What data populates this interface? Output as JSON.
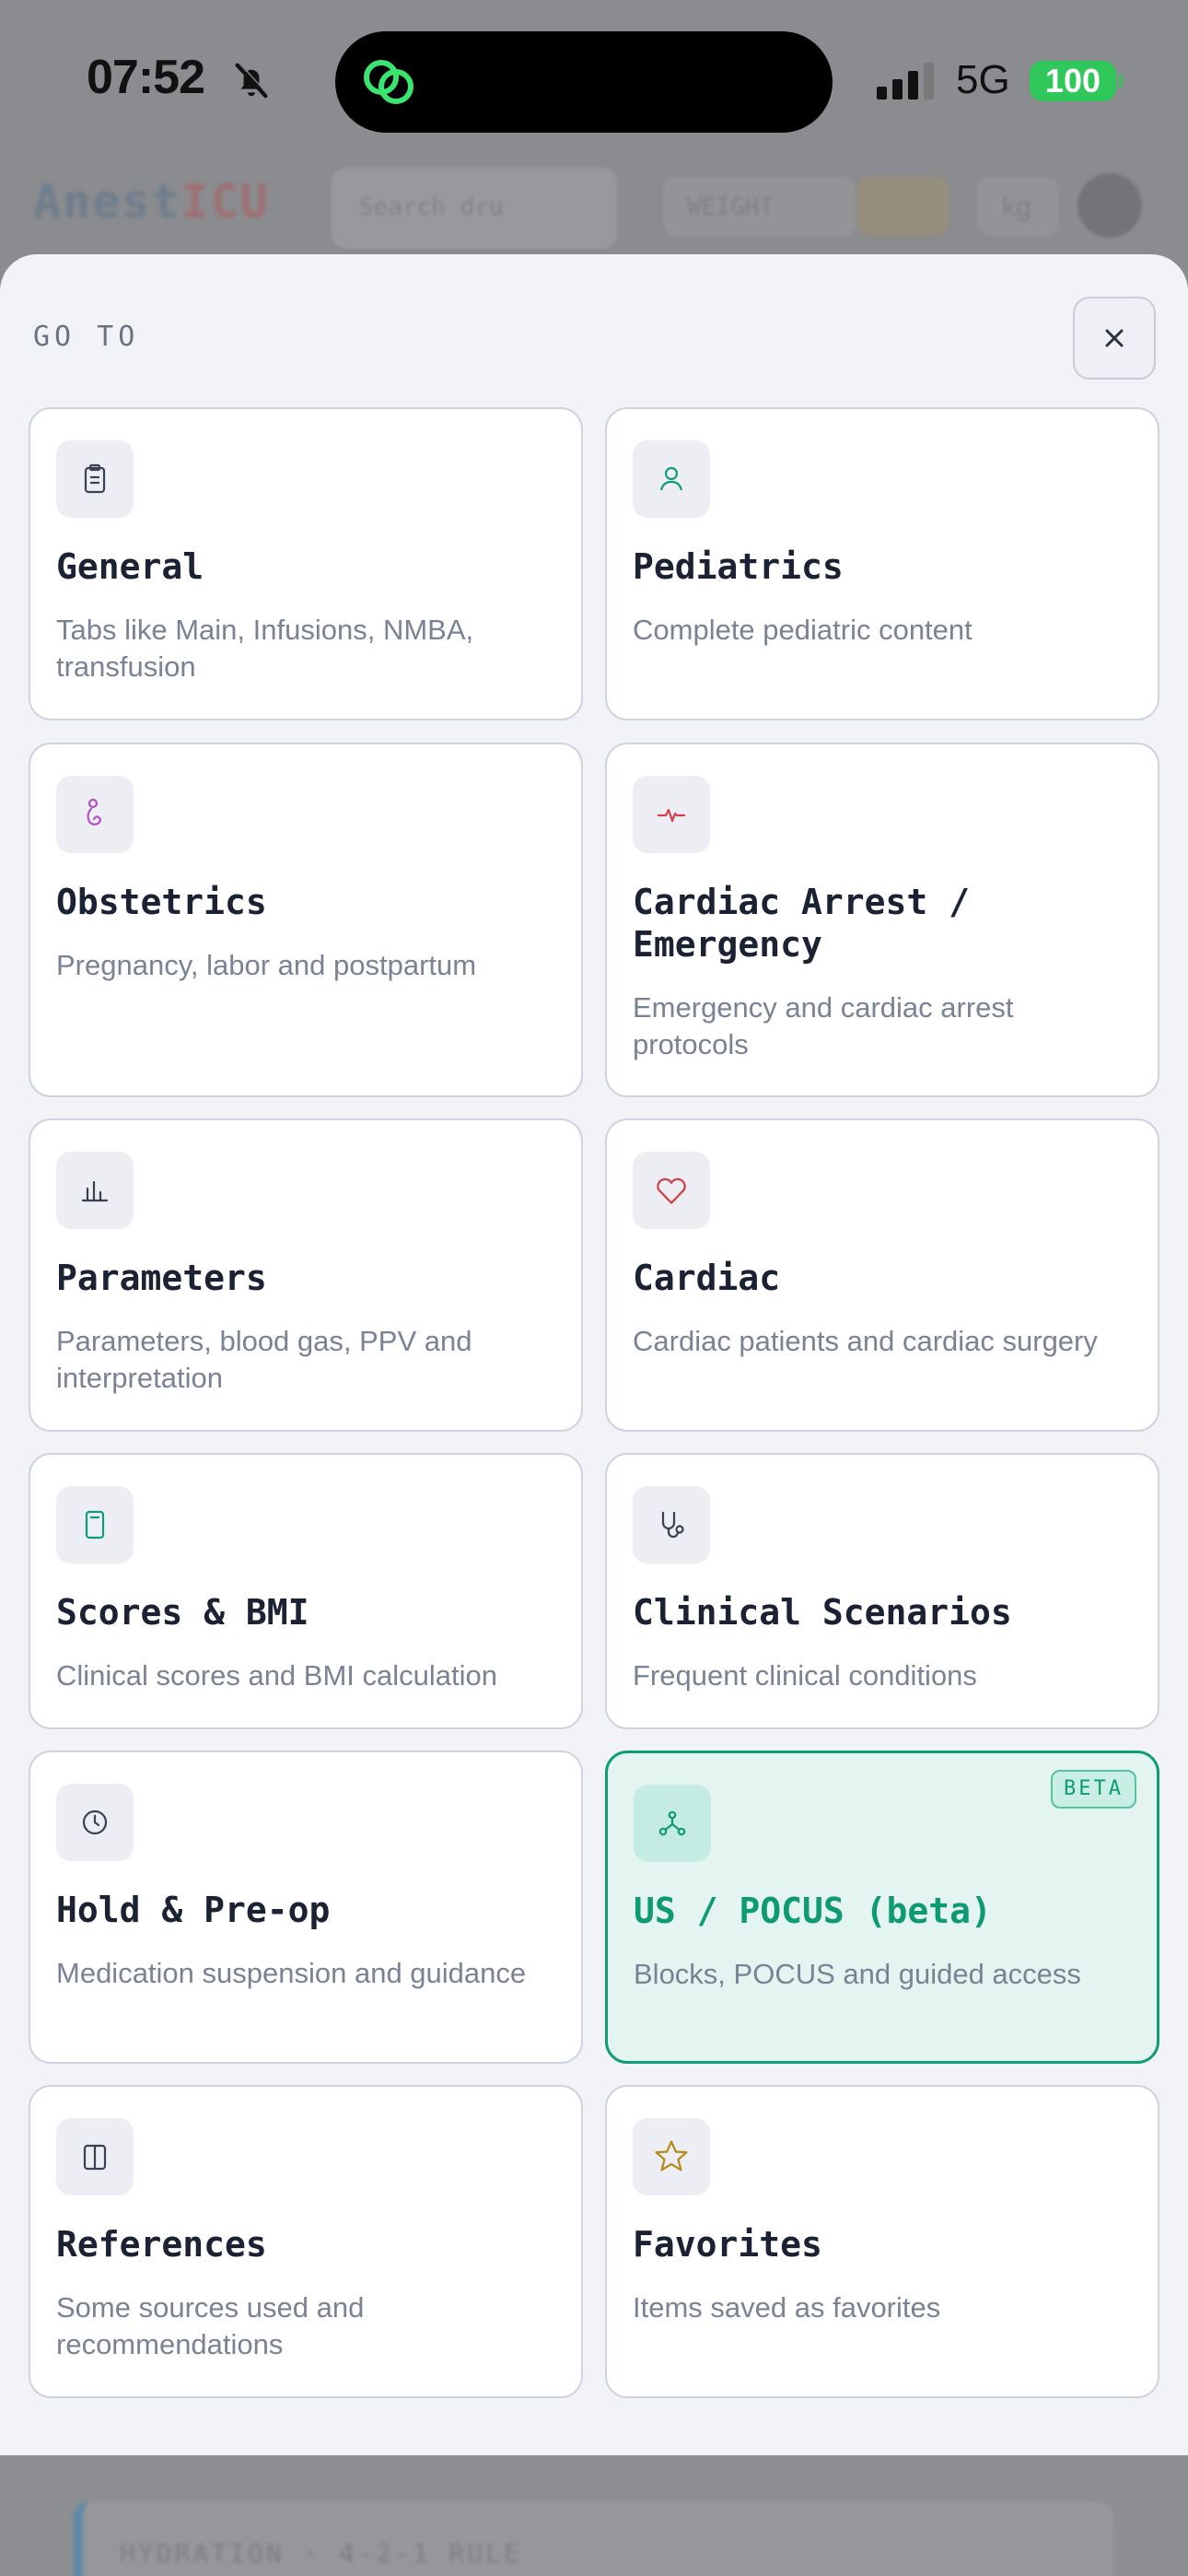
{
  "status_bar": {
    "time": "07:52",
    "network": "5G",
    "battery": "100"
  },
  "background_app": {
    "logo_part1": "Anest",
    "logo_part2": "ICU",
    "search_placeholder": "Search dru",
    "chip_label": "WEIGHT",
    "unit_label": "kg",
    "footer_text": "HYDRATION · 4-2-1 RULE"
  },
  "sheet": {
    "title": "GO TO",
    "close_symbol": "×"
  },
  "cards": [
    {
      "title": "General",
      "description": "Tabs like Main, Infusions, NMBA, transfusion",
      "icon": "clipboard-icon"
    },
    {
      "title": "Pediatrics",
      "description": "Complete pediatric content",
      "icon": "person-icon"
    },
    {
      "title": "Obstetrics",
      "description": "Pregnancy, labor and postpartum",
      "icon": "pregnant-icon"
    },
    {
      "title": "Cardiac Arrest / Emergency",
      "description": "Emergency and cardiac arrest protocols",
      "icon": "pulse-icon"
    },
    {
      "title": "Parameters",
      "description": "Parameters, blood gas, PPV and interpretation",
      "icon": "bar-chart-icon"
    },
    {
      "title": "Cardiac",
      "description": "Cardiac patients and cardiac surgery",
      "icon": "heart-icon"
    },
    {
      "title": "Scores & BMI",
      "description": "Clinical scores and BMI calculation",
      "icon": "calculator-icon"
    },
    {
      "title": "Clinical Scenarios",
      "description": "Frequent clinical conditions",
      "icon": "stethoscope-icon"
    },
    {
      "title": "Hold & Pre-op",
      "description": "Medication suspension and guidance",
      "icon": "clock-icon"
    },
    {
      "title": "US / POCUS (beta)",
      "description": "Blocks, POCUS and guided access",
      "icon": "nodes-icon",
      "badge": "BETA"
    },
    {
      "title": "References",
      "description": "Some sources used and recommendations",
      "icon": "book-icon"
    },
    {
      "title": "Favorites",
      "description": "Items saved as favorites",
      "icon": "star-icon"
    }
  ],
  "colors": {
    "accent_green": "#109c76",
    "beta_background": "#e3f4f1",
    "battery_green": "#30c85a",
    "title_text": "#1b2233",
    "muted_text": "#7a8394"
  }
}
